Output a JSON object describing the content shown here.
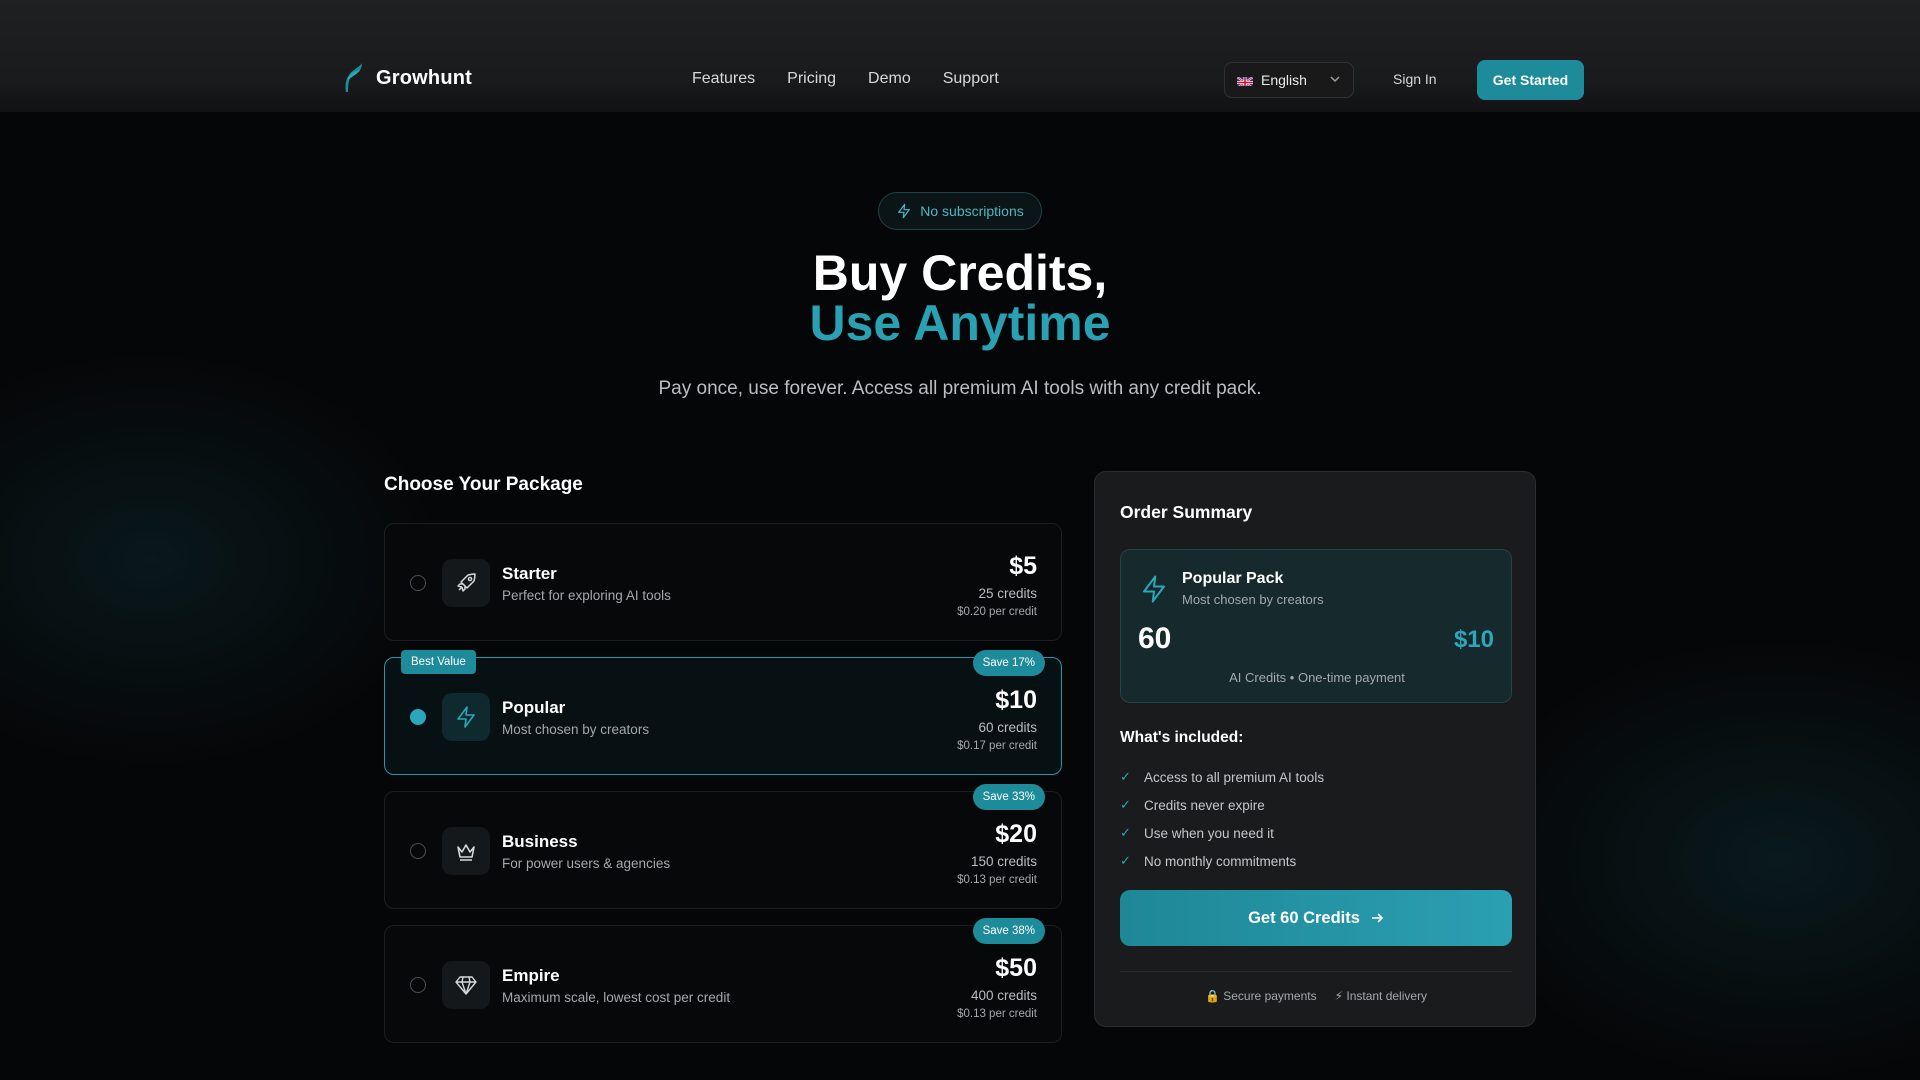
{
  "header": {
    "brand": "Growhunt",
    "nav": [
      "Features",
      "Pricing",
      "Demo",
      "Support"
    ],
    "language": "English",
    "sign_in": "Sign In",
    "get_started": "Get Started"
  },
  "hero": {
    "badge": "No subscriptions",
    "title_line1": "Buy Credits,",
    "title_line2": "Use Anytime",
    "subtitle": "Pay once, use forever. Access all premium AI tools with any credit pack."
  },
  "packages": {
    "title": "Choose Your Package",
    "items": [
      {
        "name": "Starter",
        "desc": "Perfect for exploring AI tools",
        "price": "$5",
        "credits": "25 credits",
        "per": "$0.20 per credit",
        "tag": "",
        "icon": "rocket-icon",
        "selected": false
      },
      {
        "name": "Popular",
        "desc": "Most chosen by creators",
        "price": "$10",
        "credits": "60 credits",
        "per": "$0.17 per credit",
        "tag": "Save 17%",
        "best": "Best Value",
        "icon": "lightning-icon",
        "selected": true
      },
      {
        "name": "Business",
        "desc": "For power users & agencies",
        "price": "$20",
        "credits": "150 credits",
        "per": "$0.13 per credit",
        "tag": "Save 33%",
        "icon": "crown-icon",
        "selected": false
      },
      {
        "name": "Empire",
        "desc": "Maximum scale, lowest cost per credit",
        "price": "$50",
        "credits": "400 credits",
        "per": "$0.13 per credit",
        "tag": "Save 38%",
        "icon": "diamond-icon",
        "selected": false
      }
    ]
  },
  "summary": {
    "title": "Order Summary",
    "pack_name": "Popular Pack",
    "pack_desc": "Most chosen by creators",
    "credits": "60",
    "price": "$10",
    "note": "AI Credits • One-time payment",
    "included_title": "What's included:",
    "included": [
      "Access to all premium AI tools",
      "Credits never expire",
      "Use when you need it",
      "No monthly commitments"
    ],
    "cta": "Get 60 Credits",
    "secure": "🔒 Secure payments",
    "instant": "⚡ Instant delivery"
  },
  "colors": {
    "accent": "#2aa7bb",
    "button": "#1e8b9b",
    "background": "#050607",
    "panel": "#1a1b1c"
  }
}
